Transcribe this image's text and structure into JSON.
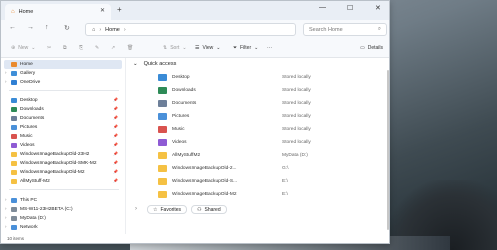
{
  "tab": {
    "title": "Home",
    "close": "✕",
    "new": "+"
  },
  "window_controls": {
    "minimize": "—",
    "maximize": "☐",
    "close": "✕"
  },
  "nav": {
    "back": "←",
    "forward": "→",
    "up": "↑",
    "refresh": "↻"
  },
  "address": {
    "home_glyph": "⌂",
    "sep1": "›",
    "path": "Home",
    "sep2": "›"
  },
  "search": {
    "placeholder": "Search Home"
  },
  "commands": {
    "new": "New",
    "cut": "✂",
    "copy": "⧉",
    "paste": "⎘",
    "rename": "✎",
    "share": "↗",
    "delete": "🗑",
    "sort": "Sort",
    "view": "View",
    "filter": "Filter",
    "more": "···",
    "details": "Details"
  },
  "sidebar": {
    "top": [
      {
        "label": "Home",
        "color": "#e98a2f",
        "selected": true
      },
      {
        "label": "Gallery",
        "color": "#3f8fd8"
      },
      {
        "label": "OneDrive",
        "color": "#2f7fd3"
      }
    ],
    "pinned": [
      {
        "label": "Desktop",
        "color": "#3a8bd6"
      },
      {
        "label": "Downloads",
        "color": "#2e8b57"
      },
      {
        "label": "Documents",
        "color": "#6d7f99"
      },
      {
        "label": "Pictures",
        "color": "#4a90d9"
      },
      {
        "label": "Music",
        "color": "#d9534f"
      },
      {
        "label": "Videos",
        "color": "#8e5bd4"
      },
      {
        "label": "WindowsImageBackupOld-23H2",
        "color": "#f5c143"
      },
      {
        "label": "WindowsImageBackupOld-SMK-M2",
        "color": "#f5c143"
      },
      {
        "label": "WindowsImageBackupOld-M2",
        "color": "#f5c143"
      },
      {
        "label": "AllMyStuff-M2",
        "color": "#f5c143"
      }
    ],
    "pc": [
      {
        "label": "This PC",
        "color": "#4a90d9"
      },
      {
        "label": "MS-W11-23H2BETA (C:)",
        "color": "#7f8c99"
      },
      {
        "label": "MyData (D:)",
        "color": "#7f8c99"
      },
      {
        "label": "Network",
        "color": "#4a90d9"
      }
    ],
    "pin_glyph": "📌"
  },
  "main": {
    "section_title": "Quick access",
    "section_chevron": "⌄",
    "rows": [
      {
        "name": "Desktop",
        "location": "Stored locally",
        "color": "#3a8bd6"
      },
      {
        "name": "Downloads",
        "location": "Stored locally",
        "color": "#2e8b57"
      },
      {
        "name": "Documents",
        "location": "Stored locally",
        "color": "#6d7f99"
      },
      {
        "name": "Pictures",
        "location": "Stored locally",
        "color": "#4a90d9"
      },
      {
        "name": "Music",
        "location": "Stored locally",
        "color": "#d9534f"
      },
      {
        "name": "Videos",
        "location": "Stored locally",
        "color": "#8e5bd4"
      },
      {
        "name": "AllMyStuffM2",
        "location": "MyData (D:)",
        "color": "#f5c143"
      },
      {
        "name": "WindowsImageBackupOld-2...",
        "location": "G:\\",
        "color": "#f5c143"
      },
      {
        "name": "WindowsImageBackupOld-S...",
        "location": "E:\\",
        "color": "#f5c143"
      },
      {
        "name": "WindowsImageBackupOld-M2",
        "location": "E:\\",
        "color": "#f5c143"
      }
    ],
    "favorites_chevron": "›",
    "favorites": "Favorites",
    "shared": "Shared"
  },
  "status": {
    "items": "10 items"
  }
}
